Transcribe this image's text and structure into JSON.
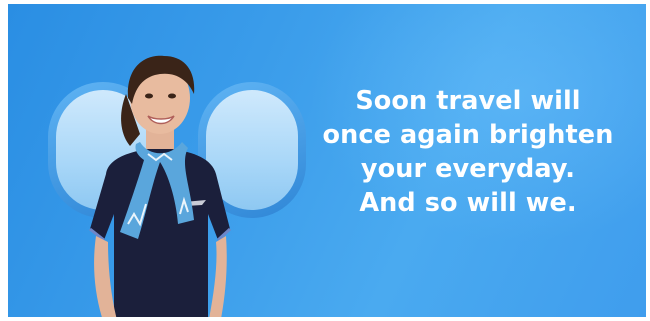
{
  "ad": {
    "headline_lines": [
      "Soon travel will",
      "once again brighten",
      "your everyday.",
      "And so will we."
    ]
  },
  "colors": {
    "background": "#3a9cea",
    "uniform": "#1b1f3b",
    "text": "#ffffff"
  }
}
